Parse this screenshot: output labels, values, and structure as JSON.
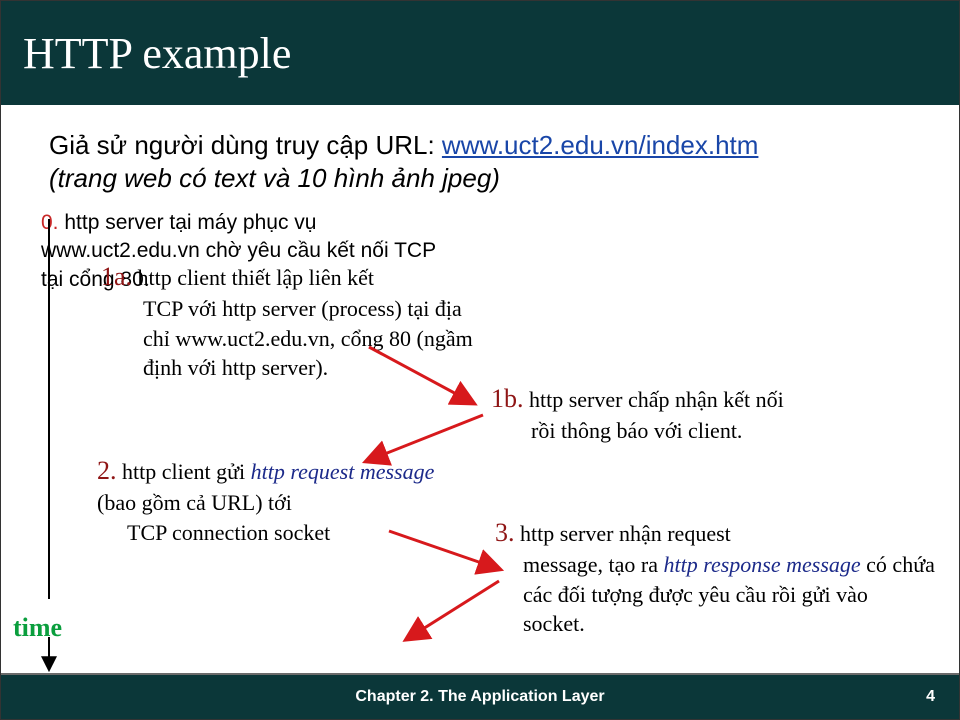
{
  "title": "HTTP example",
  "intro": {
    "prefix": "Giả sử người dùng truy cập URL: ",
    "url": "www.uct2.edu.vn/index.htm",
    "suffix": "(trang web có text và 10 hình ảnh jpeg)"
  },
  "step0": {
    "label": "0.",
    "text": " http server tại máy phục vụ www.uct2.edu.vn chờ yêu cầu kết nối TCP tại cổng 80."
  },
  "step1a": {
    "label": "1a.",
    "text": " http client thiết lập liên kết TCP với http server (process) tại địa chỉ www.uct2.edu.vn, cổng 80 (ngầm định với http server)."
  },
  "step1b": {
    "label": "1b.",
    "text": " http server chấp nhận kết nối rồi thông báo với client."
  },
  "step2": {
    "label": "2.",
    "pre": " http client gửi ",
    "em": "http request message",
    "post": " (bao gồm cả URL) tới TCP connection socket"
  },
  "step3": {
    "label": "3.",
    "pre": " http server nhận request message, tạo ra ",
    "em": "http response message",
    "post": " có chứa các đối tượng được yêu cầu rồi gửi vào socket."
  },
  "time_label": "time",
  "footer": {
    "chapter": "Chapter 2. The Application Layer",
    "page": "4"
  }
}
